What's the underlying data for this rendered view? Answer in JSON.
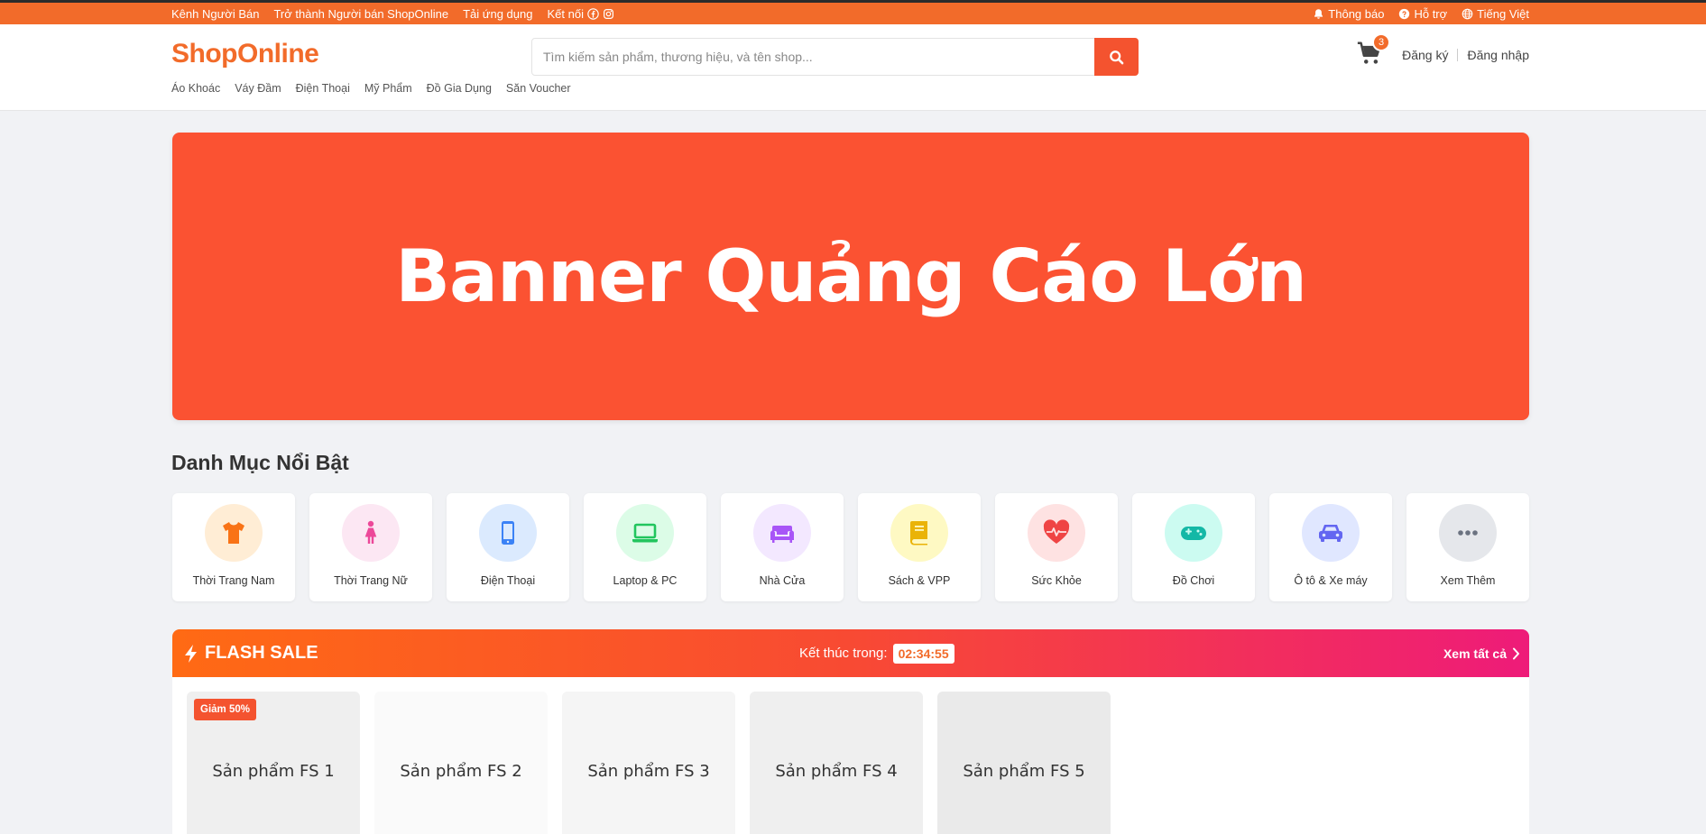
{
  "topbar": {
    "left": [
      "Kênh Người Bán",
      "Trở thành Người bán ShopOnline",
      "Tải ứng dụng",
      "Kết nối"
    ],
    "right": [
      "Thông báo",
      "Hỗ trợ",
      "Tiếng Việt"
    ]
  },
  "header": {
    "logo": "ShopOnline",
    "search_placeholder": "Tìm kiếm sản phẩm, thương hiệu, và tên shop...",
    "cart_count": "3",
    "register": "Đăng ký",
    "login": "Đăng nhập",
    "nav": [
      "Áo Khoác",
      "Váy Đầm",
      "Điện Thoại",
      "Mỹ Phẩm",
      "Đồ Gia Dụng",
      "Săn Voucher"
    ]
  },
  "banner": {
    "text": "Banner Quảng Cáo Lớn"
  },
  "categories": {
    "title": "Danh Mục Nổi Bật",
    "items": [
      {
        "label": "Thời Trang Nam",
        "icon": "shirt-icon",
        "color": "#f97316",
        "bg": "#ffedd5"
      },
      {
        "label": "Thời Trang Nữ",
        "icon": "person-dress-icon",
        "color": "#ec4899",
        "bg": "#fce7f3"
      },
      {
        "label": "Điện Thoại",
        "icon": "mobile-icon",
        "color": "#3b82f6",
        "bg": "#dbeafe"
      },
      {
        "label": "Laptop & PC",
        "icon": "laptop-icon",
        "color": "#22c55e",
        "bg": "#dcfce7"
      },
      {
        "label": "Nhà Cửa",
        "icon": "couch-icon",
        "color": "#a855f7",
        "bg": "#f3e8ff"
      },
      {
        "label": "Sách & VPP",
        "icon": "book-icon",
        "color": "#eab308",
        "bg": "#fef9c3"
      },
      {
        "label": "Sức Khỏe",
        "icon": "heart-pulse-icon",
        "color": "#ef4444",
        "bg": "#fee2e2"
      },
      {
        "label": "Đồ Chơi",
        "icon": "gamepad-icon",
        "color": "#14b8a6",
        "bg": "#ccfbf1"
      },
      {
        "label": "Ô tô & Xe máy",
        "icon": "car-icon",
        "color": "#6366f1",
        "bg": "#e0e7ff"
      },
      {
        "label": "Xem Thêm",
        "icon": "ellipsis-icon",
        "color": "#6b7280",
        "bg": "#e5e7eb"
      }
    ]
  },
  "flash_sale": {
    "title": "FLASH SALE",
    "ends_label": "Kết thúc trong:",
    "countdown": "02:34:55",
    "see_all": "Xem tất cả",
    "products": [
      {
        "name": "Sản phẩm FS 1",
        "badge": "Giảm 50%",
        "bg": "#efefef"
      },
      {
        "name": "Sản phẩm FS 2",
        "badge": "",
        "bg": "#fafafa"
      },
      {
        "name": "Sản phẩm FS 3",
        "badge": "",
        "bg": "#f5f5f5"
      },
      {
        "name": "Sản phẩm FS 4",
        "badge": "",
        "bg": "#efefef"
      },
      {
        "name": "Sản phẩm FS 5",
        "badge": "",
        "bg": "#eaeaea"
      }
    ]
  },
  "colors": {
    "brand": "#f26b2a",
    "accent": "#f4532f",
    "banner": "#fb5232"
  }
}
